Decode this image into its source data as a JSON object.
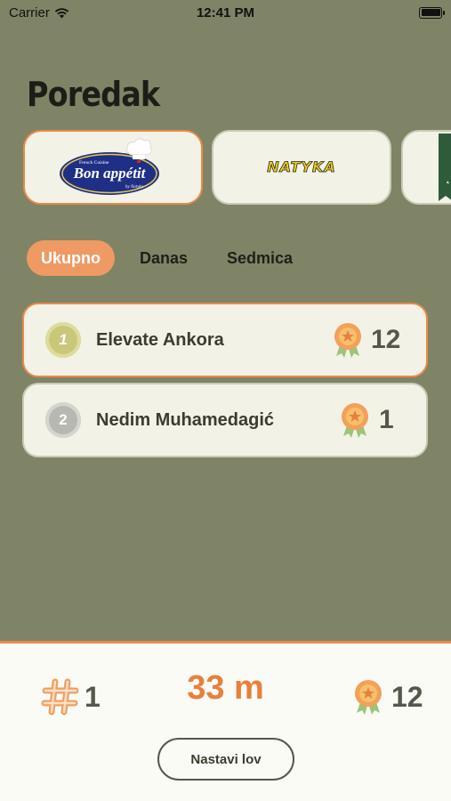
{
  "status_bar": {
    "carrier": "Carrier",
    "time": "12:41 PM"
  },
  "page": {
    "title": "Poredak"
  },
  "sponsors": [
    {
      "name": "Bon appétit",
      "small_top": "French Cuisine",
      "small_bottom": "by Natyka",
      "selected": true
    },
    {
      "name": "NATYKA",
      "selected": false
    }
  ],
  "tabs": [
    {
      "label": "Ukupno",
      "active": true
    },
    {
      "label": "Danas",
      "active": false
    },
    {
      "label": "Sedmica",
      "active": false
    }
  ],
  "leaderboard": [
    {
      "rank": "1",
      "name": "Elevate Ankora",
      "score": "12",
      "highlight": true,
      "badge_color": "#c9c77a"
    },
    {
      "rank": "2",
      "name": "Nedim Muhamedagić",
      "score": "1",
      "highlight": false,
      "badge_color": "#b8b8b2"
    }
  ],
  "footer": {
    "rank_value": "1",
    "distance": "33 m",
    "medal_count": "12",
    "continue_label": "Nastavi lov"
  },
  "colors": {
    "accent": "#e98a4a",
    "background": "#7f8466",
    "card": "#f3f2e6"
  }
}
